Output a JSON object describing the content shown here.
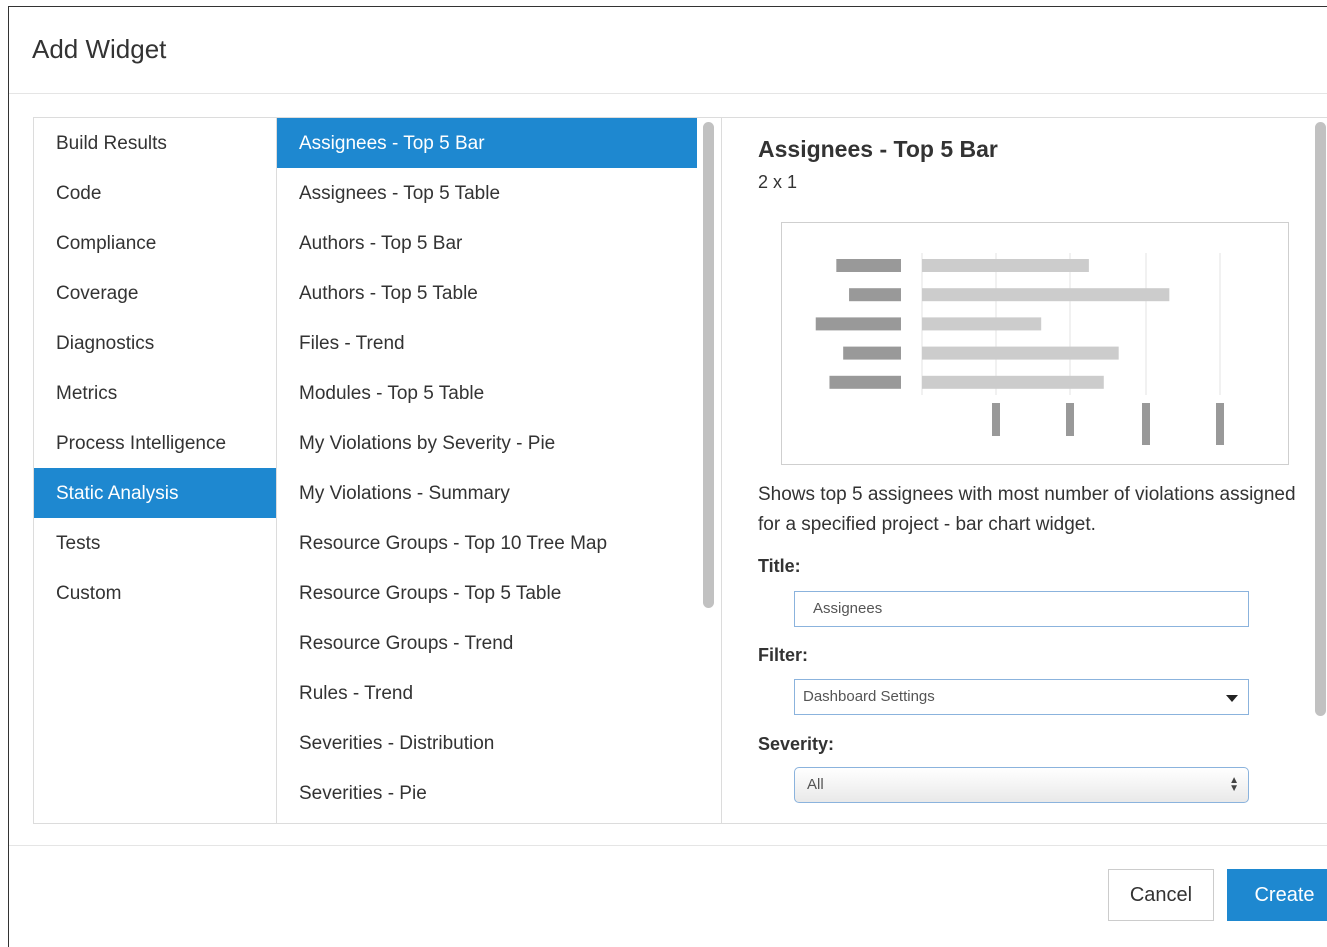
{
  "dialog": {
    "title": "Add Widget"
  },
  "categories": [
    {
      "label": "Build Results",
      "selected": false
    },
    {
      "label": "Code",
      "selected": false
    },
    {
      "label": "Compliance",
      "selected": false
    },
    {
      "label": "Coverage",
      "selected": false
    },
    {
      "label": "Diagnostics",
      "selected": false
    },
    {
      "label": "Metrics",
      "selected": false
    },
    {
      "label": "Process Intelligence",
      "selected": false
    },
    {
      "label": "Static Analysis",
      "selected": true
    },
    {
      "label": "Tests",
      "selected": false
    },
    {
      "label": "Custom",
      "selected": false
    }
  ],
  "widgets": [
    {
      "label": "Assignees - Top 5 Bar",
      "selected": true
    },
    {
      "label": "Assignees - Top 5 Table",
      "selected": false
    },
    {
      "label": "Authors - Top 5 Bar",
      "selected": false
    },
    {
      "label": "Authors - Top 5 Table",
      "selected": false
    },
    {
      "label": "Files - Trend",
      "selected": false
    },
    {
      "label": "Modules - Top 5 Table",
      "selected": false
    },
    {
      "label": "My Violations by Severity - Pie",
      "selected": false
    },
    {
      "label": "My Violations - Summary",
      "selected": false
    },
    {
      "label": "Resource Groups - Top 10 Tree Map",
      "selected": false
    },
    {
      "label": "Resource Groups - Top 5 Table",
      "selected": false
    },
    {
      "label": "Resource Groups - Trend",
      "selected": false
    },
    {
      "label": "Rules - Trend",
      "selected": false
    },
    {
      "label": "Severities - Distribution",
      "selected": false
    },
    {
      "label": "Severities - Pie",
      "selected": false
    }
  ],
  "detail": {
    "title": "Assignees - Top 5 Bar",
    "size": "2 x 1",
    "description": "Shows top 5 assignees with most number of violations assigned for a specified project - bar chart widget.",
    "preview": {
      "label_bar_lengths": [
        0.66,
        0.53,
        0.87,
        0.59,
        0.73
      ],
      "value_bar_lengths": [
        0.56,
        0.83,
        0.4,
        0.66,
        0.61
      ],
      "tick_count": 4
    },
    "form": {
      "title_label": "Title:",
      "title_value": "Assignees",
      "filter_label": "Filter:",
      "filter_value": "Dashboard Settings",
      "severity_label": "Severity:",
      "severity_value": "All"
    }
  },
  "buttons": {
    "cancel": "Cancel",
    "create": "Create"
  },
  "colors": {
    "accent": "#1e88d0",
    "preview_bar_dark": "#999999",
    "preview_bar_light": "#cccccc"
  },
  "icons": {
    "filter_dropdown": "caret-down-icon",
    "severity_dropdown": "up-down-arrows-icon"
  }
}
